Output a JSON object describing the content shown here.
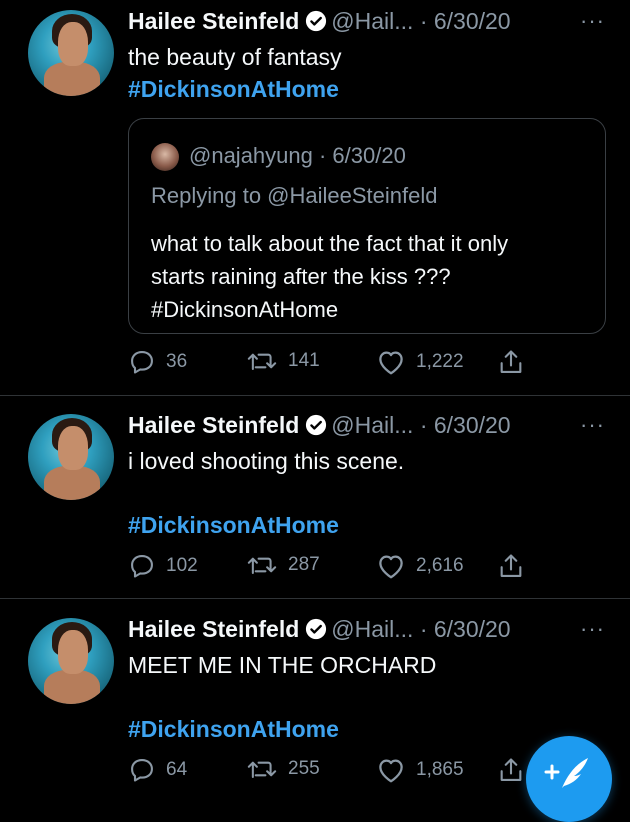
{
  "tweets": [
    {
      "name": "Hailee Steinfeld",
      "handle": "@Hail...",
      "date": "· 6/30/20",
      "more": "···",
      "text": "the beauty of fantasy",
      "hashtag": "#DickinsonAtHome",
      "quote": {
        "handle": "@najahyung · 6/30/20",
        "replying": "Replying to @HaileeSteinfeld",
        "body_lines": [
          "what to talk about the fact that it only",
          "starts raining after the kiss ???",
          "#DickinsonAtHome"
        ]
      },
      "replies": "36",
      "retweets": "141",
      "likes": "1,222"
    },
    {
      "name": "Hailee Steinfeld",
      "handle": "@Hail...",
      "date": "· 6/30/20",
      "more": "···",
      "text": "i loved shooting this scene.",
      "hashtag": "#DickinsonAtHome",
      "replies": "102",
      "retweets": "287",
      "likes": "2,616"
    },
    {
      "name": "Hailee Steinfeld",
      "handle": "@Hail...",
      "date": "· 6/30/20",
      "more": "···",
      "text": "MEET ME IN THE ORCHARD",
      "hashtag": "#DickinsonAtHome",
      "replies": "64",
      "retweets": "255",
      "likes": "1,865"
    }
  ],
  "colors": {
    "accent": "#1d9bf0",
    "hashtag": "#3fa3ef",
    "muted": "#8b98a5",
    "background": "#000000"
  },
  "icons": {
    "verified": "verified-badge-icon",
    "reply": "reply-icon",
    "retweet": "retweet-icon",
    "like": "heart-icon",
    "share": "share-icon",
    "compose": "compose-tweet-icon"
  }
}
